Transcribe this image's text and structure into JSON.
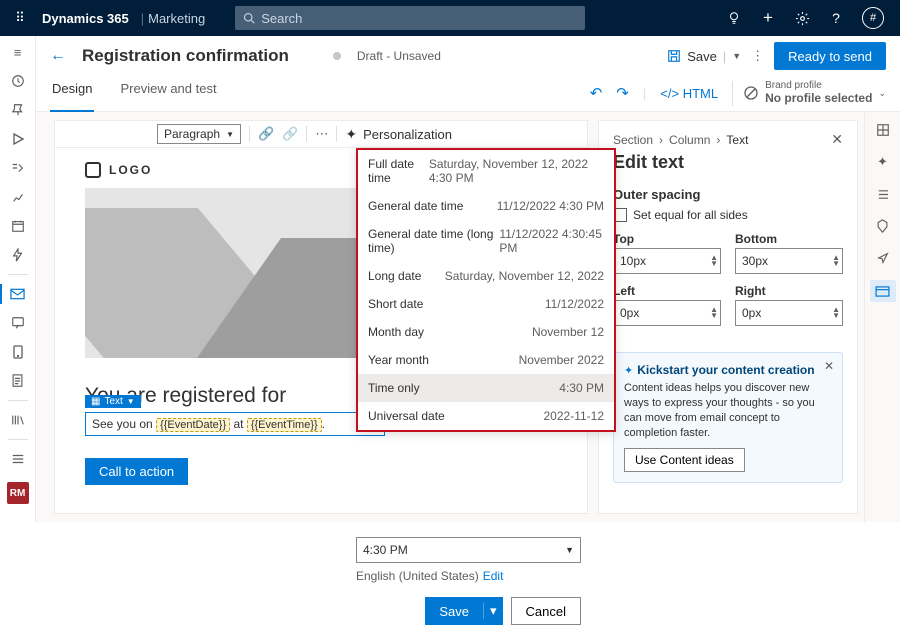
{
  "topbar": {
    "brand": "Dynamics 365",
    "product": "Marketing",
    "search_placeholder": "Search",
    "avatar": "#"
  },
  "page": {
    "title": "Registration confirmation",
    "status": "Draft - Unsaved",
    "save": "Save",
    "ready": "Ready to send"
  },
  "tabs": {
    "design": "Design",
    "preview": "Preview and test",
    "html": "HTML",
    "brand_label": "Brand profile",
    "brand_value": "No profile selected"
  },
  "toolbar": {
    "paragraph": "Paragraph",
    "personalization": "Personalization"
  },
  "canvas": {
    "logo": "LOGO",
    "headline": "You are registered for",
    "tag": "Text",
    "body_prefix": "See you on ",
    "token1": "{{EventDate}}",
    "body_mid": " at ",
    "token2": "{{EventTime}}",
    "body_suffix": ".",
    "cta": "Call to action"
  },
  "datepanel": {
    "rows": [
      {
        "l": "Full date time",
        "r": "Saturday, November 12, 2022 4:30 PM"
      },
      {
        "l": "General date time",
        "r": "11/12/2022 4:30 PM"
      },
      {
        "l": "General date time (long time)",
        "r": "11/12/2022 4:30:45 PM"
      },
      {
        "l": "Long date",
        "r": "Saturday, November 12, 2022"
      },
      {
        "l": "Short date",
        "r": "11/12/2022"
      },
      {
        "l": "Month day",
        "r": "November 12"
      },
      {
        "l": "Year month",
        "r": "November 2022"
      },
      {
        "l": "Time only",
        "r": "4:30 PM"
      },
      {
        "l": "Universal date",
        "r": "2022-11-12"
      }
    ],
    "input": "4:30 PM",
    "lang": "English (United States)",
    "edit": "Edit",
    "save": "Save",
    "cancel": "Cancel"
  },
  "side": {
    "crumb1": "Section",
    "crumb2": "Column",
    "crumb3": "Text",
    "title": "Edit text",
    "outer": "Outer spacing",
    "equal": "Set equal for all sides",
    "top_l": "Top",
    "top_v": "10px",
    "bottom_l": "Bottom",
    "bottom_v": "30px",
    "left_l": "Left",
    "left_v": "0px",
    "right_l": "Right",
    "right_v": "0px",
    "ideas_h": "Kickstart your content creation",
    "ideas_b": "Content ideas helps you discover new ways to express your thoughts - so you can move from email concept to completion faster.",
    "ideas_btn": "Use Content ideas"
  },
  "leftrail_badge": "RM"
}
